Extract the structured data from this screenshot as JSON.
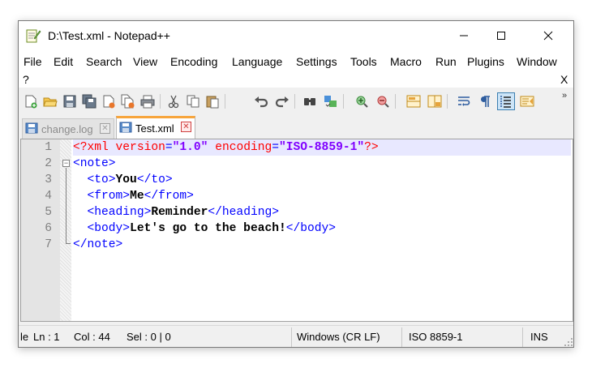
{
  "window": {
    "title": "D:\\Test.xml - Notepad++",
    "minimize_label": "—",
    "maximize_label": "☐",
    "close_label": "✕"
  },
  "menu": {
    "items": [
      "File",
      "Edit",
      "Search",
      "View",
      "Encoding",
      "Language",
      "Settings",
      "Tools",
      "Macro",
      "Run",
      "Plugins",
      "Window"
    ],
    "help": "?",
    "close_doc": "X"
  },
  "toolbar": {
    "buttons": [
      "new-file-icon",
      "open-file-icon",
      "save-icon",
      "save-all-icon",
      "close-icon",
      "close-all-icon",
      "print-icon",
      "cut-icon",
      "copy-icon",
      "paste-icon",
      "undo-icon",
      "redo-icon",
      "find-icon",
      "replace-icon",
      "zoom-in-icon",
      "zoom-out-icon",
      "sync-vertical-icon",
      "sync-horizontal-icon",
      "word-wrap-icon",
      "show-all-characters-icon",
      "indent-guide-icon",
      "document-map-icon"
    ],
    "more": "»"
  },
  "tabs": [
    {
      "label": "change.log",
      "active": false
    },
    {
      "label": "Test.xml",
      "active": true
    }
  ],
  "editor": {
    "line_numbers": [
      "1",
      "2",
      "3",
      "4",
      "5",
      "6",
      "7"
    ],
    "lines": [
      {
        "pi_open": "<?xml ",
        "attr1": "version",
        "eq1": "=",
        "val1": "\"1.0\"",
        "sp": " ",
        "attr2": "encoding",
        "eq2": "=",
        "val2": "\"ISO-8859-1\"",
        "pi_close": "?>"
      },
      {
        "open": "<note>"
      },
      {
        "indent": "  ",
        "open": "<to>",
        "text": "You",
        "close": "</to>"
      },
      {
        "indent": "  ",
        "open": "<from>",
        "text": "Me",
        "close": "</from>"
      },
      {
        "indent": "  ",
        "open": "<heading>",
        "text": "Reminder",
        "close": "</heading>"
      },
      {
        "indent": "  ",
        "open": "<body>",
        "text": "Let's go to the beach!",
        "close": "</body>"
      },
      {
        "close": "</note>"
      }
    ]
  },
  "status": {
    "length": "le",
    "ln": "Ln : 1",
    "col": "Col : 44",
    "sel": "Sel : 0 | 0",
    "eol": "Windows (CR LF)",
    "encoding": "ISO 8859-1",
    "mode": "INS"
  },
  "colors": {
    "tag": "#0000ff",
    "attribute": "#ff0000",
    "value": "#8000ff",
    "current_line": "#e8e8ff",
    "active_tab_accent": "#f7a53c"
  }
}
